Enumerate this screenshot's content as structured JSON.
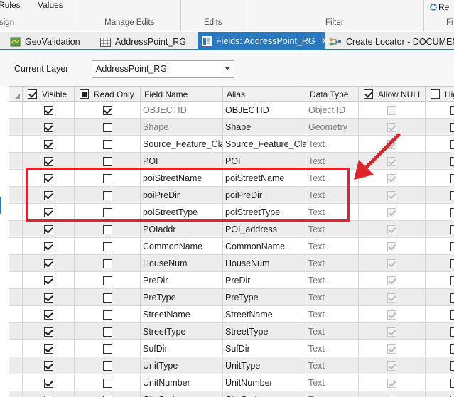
{
  "ribbon": {
    "top_items": [
      "Rules",
      "Values"
    ],
    "left_cut": "sign",
    "groups": [
      "Manage Edits",
      "Edits",
      "Filter"
    ],
    "right_item": "Re",
    "right_cut": "Fi"
  },
  "tabs": [
    {
      "label": "GeoValidation",
      "icon": "map-icon",
      "active": false
    },
    {
      "label": "AddressPoint_RG",
      "icon": "table-icon",
      "active": false
    },
    {
      "label": "Fields: AddressPoint_RG",
      "icon": "fields-icon",
      "active": true,
      "closable": true
    },
    {
      "label": "Create Locator - DOCUMENTA",
      "icon": "locator-icon",
      "active": false
    }
  ],
  "layer": {
    "label": "Current Layer",
    "value": "AddressPoint_RG"
  },
  "columns": {
    "visible": "Visible",
    "read_only": "Read Only",
    "field_name": "Field Name",
    "alias": "Alias",
    "data_type": "Data Type",
    "allow_null": "Allow NULL",
    "highlight": "Hig"
  },
  "rows": [
    {
      "field": "OBJECTID",
      "alias": "OBJECTID",
      "type": "Object ID",
      "visible": true,
      "read_only": true,
      "allow_null": false,
      "system": true
    },
    {
      "field": "Shape",
      "alias": "Shape",
      "type": "Geometry",
      "visible": true,
      "read_only": false,
      "allow_null": true,
      "system": true
    },
    {
      "field": "Source_Feature_Class",
      "alias": "Source_Feature_Class",
      "type": "Text",
      "visible": true,
      "read_only": false,
      "allow_null": true,
      "system": false
    },
    {
      "field": "POI",
      "alias": "POI",
      "type": "Text",
      "visible": true,
      "read_only": false,
      "allow_null": true,
      "system": false
    },
    {
      "field": "poiStreetName",
      "alias": "poiStreetName",
      "type": "Text",
      "visible": true,
      "read_only": false,
      "allow_null": true,
      "system": false
    },
    {
      "field": "poiPreDir",
      "alias": "poiPreDir",
      "type": "Text",
      "visible": true,
      "read_only": false,
      "allow_null": true,
      "system": false
    },
    {
      "field": "poiStreetType",
      "alias": "poiStreetType",
      "type": "Text",
      "visible": true,
      "read_only": false,
      "allow_null": true,
      "system": false
    },
    {
      "field": "POIaddr",
      "alias": "POI_address",
      "type": "Text",
      "visible": true,
      "read_only": false,
      "allow_null": true,
      "system": false
    },
    {
      "field": "CommonName",
      "alias": "CommonName",
      "type": "Text",
      "visible": true,
      "read_only": false,
      "allow_null": true,
      "system": false
    },
    {
      "field": "HouseNum",
      "alias": "HouseNum",
      "type": "Text",
      "visible": true,
      "read_only": false,
      "allow_null": true,
      "system": false
    },
    {
      "field": "PreDir",
      "alias": "PreDir",
      "type": "Text",
      "visible": true,
      "read_only": false,
      "allow_null": true,
      "system": false
    },
    {
      "field": "PreType",
      "alias": "PreType",
      "type": "Text",
      "visible": true,
      "read_only": false,
      "allow_null": true,
      "system": false
    },
    {
      "field": "StreetName",
      "alias": "StreetName",
      "type": "Text",
      "visible": true,
      "read_only": false,
      "allow_null": true,
      "system": false
    },
    {
      "field": "StreetType",
      "alias": "StreetType",
      "type": "Text",
      "visible": true,
      "read_only": false,
      "allow_null": true,
      "system": false
    },
    {
      "field": "SufDir",
      "alias": "SufDir",
      "type": "Text",
      "visible": true,
      "read_only": false,
      "allow_null": true,
      "system": false
    },
    {
      "field": "UnitType",
      "alias": "UnitType",
      "type": "Text",
      "visible": true,
      "read_only": false,
      "allow_null": true,
      "system": false
    },
    {
      "field": "UnitNumber",
      "alias": "UnitNumber",
      "type": "Text",
      "visible": true,
      "read_only": false,
      "allow_null": true,
      "system": false
    },
    {
      "field": "CityCode",
      "alias": "CityCode",
      "type": "Text",
      "visible": true,
      "read_only": false,
      "allow_null": true,
      "system": false
    }
  ],
  "annotation": {
    "highlight_color": "#e0232a"
  },
  "colors": {
    "accent": "#2a78bf",
    "highlight": "#e0232a"
  }
}
